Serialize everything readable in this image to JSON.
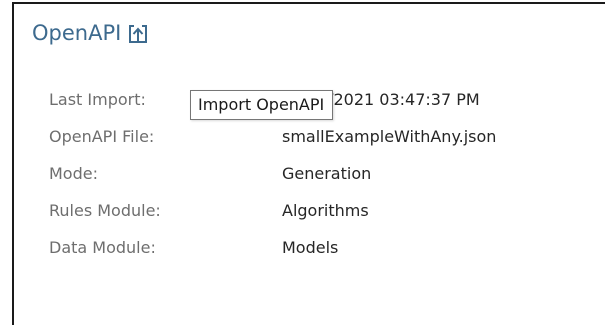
{
  "section": {
    "title": "OpenAPI",
    "import_icon": "import-upload-icon",
    "accent_color": "#3d6a8e"
  },
  "tooltip": {
    "text": "Import OpenAPI"
  },
  "details": [
    {
      "label": "Last Import:",
      "value": "07/13/2021 03:47:37 PM"
    },
    {
      "label": "OpenAPI File:",
      "value": "smallExampleWithAny.json"
    },
    {
      "label": "Mode:",
      "value": "Generation"
    },
    {
      "label": "Rules Module:",
      "value": "Algorithms"
    },
    {
      "label": "Data Module:",
      "value": "Models"
    }
  ]
}
